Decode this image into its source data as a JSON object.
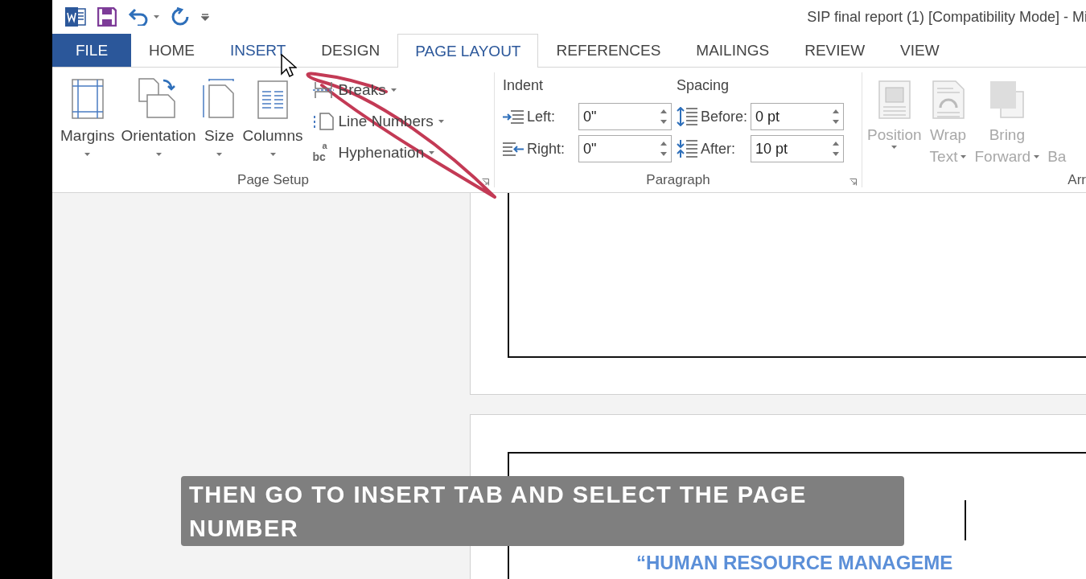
{
  "title_bar": {
    "title": "SIP final report (1) [Compatibility Mode] - Mi"
  },
  "tabs": [
    {
      "label": "FILE",
      "kind": "file",
      "selected": false,
      "hovered": false
    },
    {
      "label": "HOME",
      "kind": "tab",
      "selected": false,
      "hovered": false
    },
    {
      "label": "INSERT",
      "kind": "tab",
      "selected": false,
      "hovered": true
    },
    {
      "label": "DESIGN",
      "kind": "tab",
      "selected": false,
      "hovered": false
    },
    {
      "label": "PAGE LAYOUT",
      "kind": "tab",
      "selected": true,
      "hovered": false
    },
    {
      "label": "REFERENCES",
      "kind": "tab",
      "selected": false,
      "hovered": false
    },
    {
      "label": "MAILINGS",
      "kind": "tab",
      "selected": false,
      "hovered": false
    },
    {
      "label": "REVIEW",
      "kind": "tab",
      "selected": false,
      "hovered": false
    },
    {
      "label": "VIEW",
      "kind": "tab",
      "selected": false,
      "hovered": false
    }
  ],
  "page_setup": {
    "label": "Page Setup",
    "large_buttons": [
      {
        "label": "Margins",
        "kind": "margins"
      },
      {
        "label": "Orientation",
        "kind": "orientation"
      },
      {
        "label": "Size",
        "kind": "size"
      },
      {
        "label": "Columns",
        "kind": "columns"
      }
    ],
    "small_buttons": [
      {
        "label": "Breaks",
        "kind": "breaks"
      },
      {
        "label": "Line Numbers",
        "kind": "line-numbers"
      },
      {
        "label": "Hyphenation",
        "kind": "hyphenation",
        "icon_top": "a",
        "icon_bottom": "bc"
      }
    ]
  },
  "paragraph": {
    "label": "Paragraph",
    "indent": {
      "label": "Indent",
      "fields": [
        {
          "kind": "indent-left",
          "label": "Left:",
          "value": "0\""
        },
        {
          "kind": "indent-right",
          "label": "Right:",
          "value": "0\""
        }
      ]
    },
    "spacing": {
      "label": "Spacing",
      "fields": [
        {
          "kind": "space-before",
          "label": "Before:",
          "value": "0 pt"
        },
        {
          "kind": "space-after",
          "label": "After:",
          "value": "10 pt"
        }
      ]
    }
  },
  "arrange": {
    "label": "Arr",
    "buttons": [
      {
        "kind": "position",
        "lines": [
          "Position"
        ],
        "disabled": true
      },
      {
        "kind": "wrap",
        "lines": [
          "Wrap",
          "Text"
        ],
        "disabled": true
      },
      {
        "kind": "forward",
        "lines": [
          "Bring",
          "Forward"
        ],
        "disabled": true
      },
      {
        "kind": "backward",
        "lines": [
          "Ba"
        ],
        "disabled": true
      }
    ]
  },
  "document": {
    "heading": "“HUMAN RESOURCE MANAGEME"
  },
  "caption": {
    "text": "THEN GO TO INSERT TAB AND SELECT THE PAGE NUMBER"
  }
}
